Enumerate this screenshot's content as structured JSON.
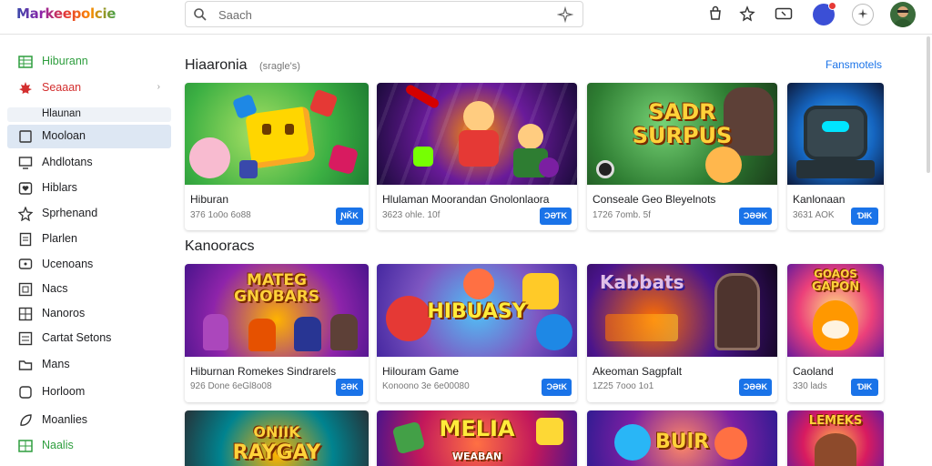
{
  "header": {
    "logo": "Markeepolcie",
    "search_placeholder": "Saach"
  },
  "sidebar": {
    "items": [
      {
        "label": "Hiburann",
        "icon": "grid-icon",
        "color": "#2e9e3e"
      },
      {
        "label": "Seaaan",
        "icon": "maple-leaf-icon",
        "color": "#d32f2f"
      },
      {
        "label": "Hlaunan",
        "icon": "",
        "color": "#202124"
      },
      {
        "label": "Mooloan",
        "icon": "tablet-icon",
        "color": "#202124"
      },
      {
        "label": "Ahdlotans",
        "icon": "monitor-icon",
        "color": "#202124"
      },
      {
        "label": "Hiblars",
        "icon": "heart-icon",
        "color": "#202124"
      },
      {
        "label": "Sprhenand",
        "icon": "star-icon",
        "color": "#202124"
      },
      {
        "label": "Plarlen",
        "icon": "document-icon",
        "color": "#202124"
      },
      {
        "label": "Ucenoans",
        "icon": "chat-icon",
        "color": "#202124"
      },
      {
        "label": "Nacs",
        "icon": "grid-small-icon",
        "color": "#202124"
      },
      {
        "label": "Nanoros",
        "icon": "grid-small-icon",
        "color": "#202124"
      },
      {
        "label": "Cartat Setons",
        "icon": "list-icon",
        "color": "#202124"
      },
      {
        "label": "Mans",
        "icon": "folder-icon",
        "color": "#202124"
      },
      {
        "label": "Horloom",
        "icon": "tag-icon",
        "color": "#202124"
      },
      {
        "label": "Moanlies",
        "icon": "leaf-icon",
        "color": "#202124"
      },
      {
        "label": "Naalis",
        "icon": "grid-icon",
        "color": "#2e9e3e"
      }
    ]
  },
  "sections": [
    {
      "title": "Hiaaronia",
      "subtitle": "(sragle's)",
      "link": "Fansmotels",
      "cards": [
        {
          "title": "Hiburan",
          "meta": "376 1o0o 6o88",
          "button": "ƝǨK",
          "theme": "puzzle"
        },
        {
          "title": "Hlulaman Moorandan Gnolonlaora",
          "meta": "3623 ohle. 10f",
          "button": "ƆƏƬK",
          "theme": "arcade"
        },
        {
          "title": "Conseale Geo Bleyelnots",
          "meta": "1726 7omb. 5f",
          "button": "ƆƏƏK",
          "theme": "sadr",
          "thumb_text": [
            "SADR",
            "SURPUS"
          ]
        },
        {
          "title": "Kanlonaan",
          "meta": "3631 AOK",
          "button": "ƊłK",
          "theme": "robot"
        }
      ]
    },
    {
      "title": "Kanooracs",
      "subtitle": "",
      "link": "",
      "cards": [
        {
          "title": "Hiburnan Romekes Sindrarels",
          "meta": "926 Done 6eGl8o08",
          "button": "ƧƏK",
          "theme": "heroes",
          "thumb_text": [
            "MATEG",
            "GNOBARS"
          ]
        },
        {
          "title": "Hilouram Game",
          "meta": "Konoono 3e 6e00080",
          "button": "ƆƏtK",
          "theme": "candy",
          "thumb_text": [
            "HIBUASY"
          ]
        },
        {
          "title": "Akeoman Sagpfalt",
          "meta": "1Z25 7ooo 1o1",
          "button": "ƆƏƏK",
          "theme": "dark",
          "thumb_text": [
            "Kabbats"
          ]
        },
        {
          "title": "Caoland",
          "meta": "330 lads",
          "button": "ƊłK",
          "theme": "dog",
          "thumb_text": [
            "GOAOS",
            "GAPON"
          ]
        }
      ]
    },
    {
      "title": "",
      "subtitle": "",
      "link": "",
      "cards": [
        {
          "title": "",
          "meta": "",
          "button": "",
          "theme": "rayday",
          "thumb_text": [
            "ONIIK",
            "RAYGAY"
          ]
        },
        {
          "title": "",
          "meta": "",
          "button": "",
          "theme": "melia",
          "thumb_text": [
            "MELIA",
            "WEABAN"
          ]
        },
        {
          "title": "",
          "meta": "",
          "button": "",
          "theme": "bulr",
          "thumb_text": [
            "BUlR"
          ]
        },
        {
          "title": "",
          "meta": "",
          "button": "",
          "theme": "lemeks",
          "thumb_text": [
            "LEMEKS"
          ]
        }
      ]
    }
  ],
  "colors": {
    "accent": "#1a73e8",
    "active_bg": "#dde7f3",
    "green": "#2e9e3e",
    "red": "#d32f2f"
  }
}
